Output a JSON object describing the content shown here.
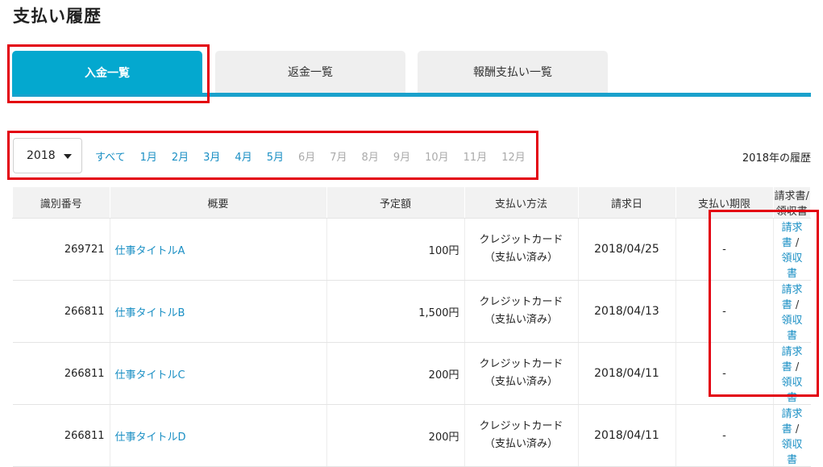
{
  "page": {
    "title": "支払い履歴"
  },
  "tabs": [
    {
      "label": "入金一覧",
      "active": true
    },
    {
      "label": "返金一覧",
      "active": false
    },
    {
      "label": "報酬支払い一覧",
      "active": false
    }
  ],
  "filter": {
    "year": "2018",
    "all_label": "すべて",
    "months": [
      {
        "label": "1月",
        "enabled": true
      },
      {
        "label": "2月",
        "enabled": true
      },
      {
        "label": "3月",
        "enabled": true
      },
      {
        "label": "4月",
        "enabled": true
      },
      {
        "label": "5月",
        "enabled": true
      },
      {
        "label": "6月",
        "enabled": false
      },
      {
        "label": "7月",
        "enabled": false
      },
      {
        "label": "8月",
        "enabled": false
      },
      {
        "label": "9月",
        "enabled": false
      },
      {
        "label": "10月",
        "enabled": false
      },
      {
        "label": "11月",
        "enabled": false
      },
      {
        "label": "12月",
        "enabled": false
      }
    ],
    "history_label": "2018年の履歴"
  },
  "table": {
    "headers": [
      "識別番号",
      "概要",
      "予定額",
      "支払い方法",
      "請求日",
      "支払い期限",
      "請求書/領収書"
    ],
    "rows": [
      {
        "id": "269721",
        "title": "仕事タイトルA",
        "amount": "100円",
        "method_line1": "クレジットカード",
        "method_line2": "（支払い済み）",
        "date": "2018/04/25",
        "deadline": "-",
        "invoice": "請求書",
        "sep": "/",
        "receipt": "領収書"
      },
      {
        "id": "266811",
        "title": "仕事タイトルB",
        "amount": "1,500円",
        "method_line1": "クレジットカード",
        "method_line2": "（支払い済み）",
        "date": "2018/04/13",
        "deadline": "-",
        "invoice": "請求書",
        "sep": "/",
        "receipt": "領収書"
      },
      {
        "id": "266811",
        "title": "仕事タイトルC",
        "amount": "200円",
        "method_line1": "クレジットカード",
        "method_line2": "（支払い済み）",
        "date": "2018/04/11",
        "deadline": "-",
        "invoice": "請求書",
        "sep": "/",
        "receipt": "領収書"
      },
      {
        "id": "266811",
        "title": "仕事タイトルD",
        "amount": "200円",
        "method_line1": "クレジットカード",
        "method_line2": "（支払い済み）",
        "date": "2018/04/11",
        "deadline": "-",
        "invoice": "請求書",
        "sep": "/",
        "receipt": "領収書"
      }
    ]
  },
  "colors": {
    "accent": "#04a8cf",
    "link": "#1a8fc4",
    "highlight": "#e3000f"
  }
}
